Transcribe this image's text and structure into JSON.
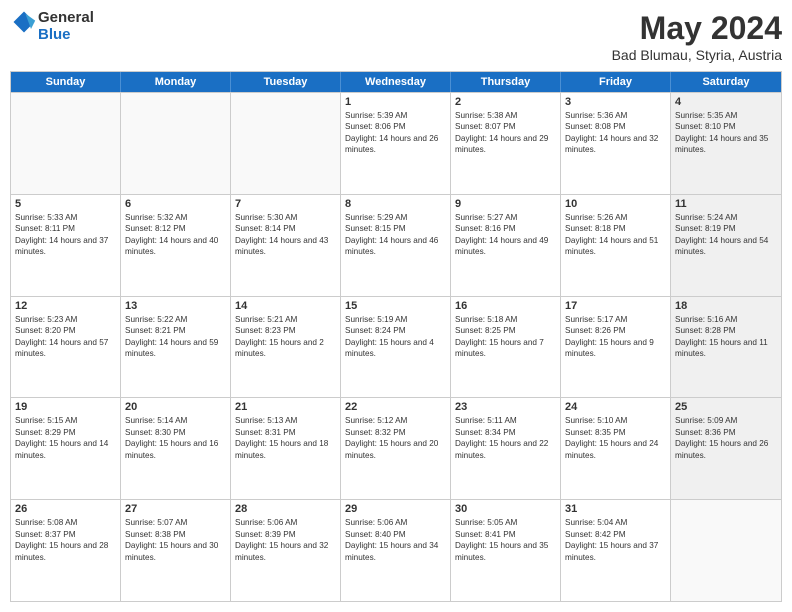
{
  "logo": {
    "line1": "General",
    "line2": "Blue"
  },
  "title": "May 2024",
  "location": "Bad Blumau, Styria, Austria",
  "days_of_week": [
    "Sunday",
    "Monday",
    "Tuesday",
    "Wednesday",
    "Thursday",
    "Friday",
    "Saturday"
  ],
  "weeks": [
    [
      {
        "day": "",
        "sunrise": "",
        "sunset": "",
        "daylight": "",
        "shaded": false,
        "empty": true
      },
      {
        "day": "",
        "sunrise": "",
        "sunset": "",
        "daylight": "",
        "shaded": false,
        "empty": true
      },
      {
        "day": "",
        "sunrise": "",
        "sunset": "",
        "daylight": "",
        "shaded": false,
        "empty": true
      },
      {
        "day": "1",
        "sunrise": "Sunrise: 5:39 AM",
        "sunset": "Sunset: 8:06 PM",
        "daylight": "Daylight: 14 hours and 26 minutes.",
        "shaded": false,
        "empty": false
      },
      {
        "day": "2",
        "sunrise": "Sunrise: 5:38 AM",
        "sunset": "Sunset: 8:07 PM",
        "daylight": "Daylight: 14 hours and 29 minutes.",
        "shaded": false,
        "empty": false
      },
      {
        "day": "3",
        "sunrise": "Sunrise: 5:36 AM",
        "sunset": "Sunset: 8:08 PM",
        "daylight": "Daylight: 14 hours and 32 minutes.",
        "shaded": false,
        "empty": false
      },
      {
        "day": "4",
        "sunrise": "Sunrise: 5:35 AM",
        "sunset": "Sunset: 8:10 PM",
        "daylight": "Daylight: 14 hours and 35 minutes.",
        "shaded": true,
        "empty": false
      }
    ],
    [
      {
        "day": "5",
        "sunrise": "Sunrise: 5:33 AM",
        "sunset": "Sunset: 8:11 PM",
        "daylight": "Daylight: 14 hours and 37 minutes.",
        "shaded": false,
        "empty": false
      },
      {
        "day": "6",
        "sunrise": "Sunrise: 5:32 AM",
        "sunset": "Sunset: 8:12 PM",
        "daylight": "Daylight: 14 hours and 40 minutes.",
        "shaded": false,
        "empty": false
      },
      {
        "day": "7",
        "sunrise": "Sunrise: 5:30 AM",
        "sunset": "Sunset: 8:14 PM",
        "daylight": "Daylight: 14 hours and 43 minutes.",
        "shaded": false,
        "empty": false
      },
      {
        "day": "8",
        "sunrise": "Sunrise: 5:29 AM",
        "sunset": "Sunset: 8:15 PM",
        "daylight": "Daylight: 14 hours and 46 minutes.",
        "shaded": false,
        "empty": false
      },
      {
        "day": "9",
        "sunrise": "Sunrise: 5:27 AM",
        "sunset": "Sunset: 8:16 PM",
        "daylight": "Daylight: 14 hours and 49 minutes.",
        "shaded": false,
        "empty": false
      },
      {
        "day": "10",
        "sunrise": "Sunrise: 5:26 AM",
        "sunset": "Sunset: 8:18 PM",
        "daylight": "Daylight: 14 hours and 51 minutes.",
        "shaded": false,
        "empty": false
      },
      {
        "day": "11",
        "sunrise": "Sunrise: 5:24 AM",
        "sunset": "Sunset: 8:19 PM",
        "daylight": "Daylight: 14 hours and 54 minutes.",
        "shaded": true,
        "empty": false
      }
    ],
    [
      {
        "day": "12",
        "sunrise": "Sunrise: 5:23 AM",
        "sunset": "Sunset: 8:20 PM",
        "daylight": "Daylight: 14 hours and 57 minutes.",
        "shaded": false,
        "empty": false
      },
      {
        "day": "13",
        "sunrise": "Sunrise: 5:22 AM",
        "sunset": "Sunset: 8:21 PM",
        "daylight": "Daylight: 14 hours and 59 minutes.",
        "shaded": false,
        "empty": false
      },
      {
        "day": "14",
        "sunrise": "Sunrise: 5:21 AM",
        "sunset": "Sunset: 8:23 PM",
        "daylight": "Daylight: 15 hours and 2 minutes.",
        "shaded": false,
        "empty": false
      },
      {
        "day": "15",
        "sunrise": "Sunrise: 5:19 AM",
        "sunset": "Sunset: 8:24 PM",
        "daylight": "Daylight: 15 hours and 4 minutes.",
        "shaded": false,
        "empty": false
      },
      {
        "day": "16",
        "sunrise": "Sunrise: 5:18 AM",
        "sunset": "Sunset: 8:25 PM",
        "daylight": "Daylight: 15 hours and 7 minutes.",
        "shaded": false,
        "empty": false
      },
      {
        "day": "17",
        "sunrise": "Sunrise: 5:17 AM",
        "sunset": "Sunset: 8:26 PM",
        "daylight": "Daylight: 15 hours and 9 minutes.",
        "shaded": false,
        "empty": false
      },
      {
        "day": "18",
        "sunrise": "Sunrise: 5:16 AM",
        "sunset": "Sunset: 8:28 PM",
        "daylight": "Daylight: 15 hours and 11 minutes.",
        "shaded": true,
        "empty": false
      }
    ],
    [
      {
        "day": "19",
        "sunrise": "Sunrise: 5:15 AM",
        "sunset": "Sunset: 8:29 PM",
        "daylight": "Daylight: 15 hours and 14 minutes.",
        "shaded": false,
        "empty": false
      },
      {
        "day": "20",
        "sunrise": "Sunrise: 5:14 AM",
        "sunset": "Sunset: 8:30 PM",
        "daylight": "Daylight: 15 hours and 16 minutes.",
        "shaded": false,
        "empty": false
      },
      {
        "day": "21",
        "sunrise": "Sunrise: 5:13 AM",
        "sunset": "Sunset: 8:31 PM",
        "daylight": "Daylight: 15 hours and 18 minutes.",
        "shaded": false,
        "empty": false
      },
      {
        "day": "22",
        "sunrise": "Sunrise: 5:12 AM",
        "sunset": "Sunset: 8:32 PM",
        "daylight": "Daylight: 15 hours and 20 minutes.",
        "shaded": false,
        "empty": false
      },
      {
        "day": "23",
        "sunrise": "Sunrise: 5:11 AM",
        "sunset": "Sunset: 8:34 PM",
        "daylight": "Daylight: 15 hours and 22 minutes.",
        "shaded": false,
        "empty": false
      },
      {
        "day": "24",
        "sunrise": "Sunrise: 5:10 AM",
        "sunset": "Sunset: 8:35 PM",
        "daylight": "Daylight: 15 hours and 24 minutes.",
        "shaded": false,
        "empty": false
      },
      {
        "day": "25",
        "sunrise": "Sunrise: 5:09 AM",
        "sunset": "Sunset: 8:36 PM",
        "daylight": "Daylight: 15 hours and 26 minutes.",
        "shaded": true,
        "empty": false
      }
    ],
    [
      {
        "day": "26",
        "sunrise": "Sunrise: 5:08 AM",
        "sunset": "Sunset: 8:37 PM",
        "daylight": "Daylight: 15 hours and 28 minutes.",
        "shaded": false,
        "empty": false
      },
      {
        "day": "27",
        "sunrise": "Sunrise: 5:07 AM",
        "sunset": "Sunset: 8:38 PM",
        "daylight": "Daylight: 15 hours and 30 minutes.",
        "shaded": false,
        "empty": false
      },
      {
        "day": "28",
        "sunrise": "Sunrise: 5:06 AM",
        "sunset": "Sunset: 8:39 PM",
        "daylight": "Daylight: 15 hours and 32 minutes.",
        "shaded": false,
        "empty": false
      },
      {
        "day": "29",
        "sunrise": "Sunrise: 5:06 AM",
        "sunset": "Sunset: 8:40 PM",
        "daylight": "Daylight: 15 hours and 34 minutes.",
        "shaded": false,
        "empty": false
      },
      {
        "day": "30",
        "sunrise": "Sunrise: 5:05 AM",
        "sunset": "Sunset: 8:41 PM",
        "daylight": "Daylight: 15 hours and 35 minutes.",
        "shaded": false,
        "empty": false
      },
      {
        "day": "31",
        "sunrise": "Sunrise: 5:04 AM",
        "sunset": "Sunset: 8:42 PM",
        "daylight": "Daylight: 15 hours and 37 minutes.",
        "shaded": false,
        "empty": false
      },
      {
        "day": "",
        "sunrise": "",
        "sunset": "",
        "daylight": "",
        "shaded": true,
        "empty": true
      }
    ]
  ]
}
